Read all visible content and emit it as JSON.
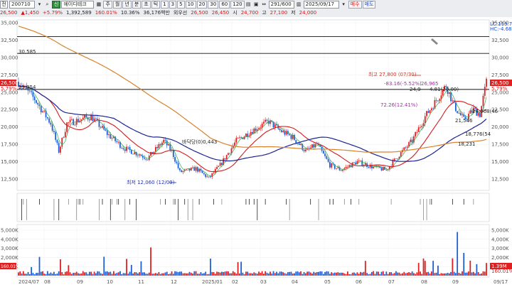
{
  "toolbar": {
    "row1": {
      "menu_label": "전",
      "stock_code": "200710",
      "dropdown_icon": "chevron-down-icon",
      "search_icon": "search-icon",
      "badge": "신",
      "stock_name": "에이디테크",
      "period_buttons": [
        "주",
        "월",
        "년",
        "분",
        "초",
        "틱"
      ],
      "interval_buttons": [
        "1",
        "3",
        "5",
        "10",
        "20",
        "30",
        "60",
        "120"
      ],
      "count_value": "291/600",
      "date_value": "2025/09/17",
      "mode_buttons": [
        "매수",
        "매도"
      ]
    },
    "row2": {
      "price": "26,500",
      "change": "1,450",
      "change_pct": "+5.79%",
      "volume": "1,392,589",
      "vol_ratio": "160.01%",
      "turnover": "10.36%",
      "amount": "36,176백만",
      "foreign_label": "외우선",
      "open_value": "26,500",
      "prev_value": "26,450",
      "open_label": "시",
      "open_price": "24,700",
      "high_label": "고",
      "high_price": "27,100",
      "low_label": "저",
      "low_price": "24,000"
    }
  },
  "chart": {
    "price_axis_ticks": [
      "35,000",
      "32,500",
      "30,000",
      "27,500",
      "25,000",
      "22,500",
      "20,000",
      "17,500",
      "15,000",
      "12,500"
    ],
    "volume_axis_ticks": [
      "5,000K",
      "4,000K",
      "3,000K",
      "2,000K",
      "1,000K"
    ],
    "left_ticks": [
      "35,000",
      "32,500",
      "30,000",
      "27,500",
      "25,000",
      "22,500",
      "20,000",
      "17,500",
      "15,000",
      "12,500"
    ],
    "left_price_box": "26,500",
    "left_pct": "5.79%",
    "left_level_label": "30,585",
    "left_low_label": "25,954",
    "left_vol_ticks": [
      "5,000K",
      "4,000K",
      "3,000K",
      "2,000K",
      "1,000K"
    ],
    "left_vol_box": "160.01%",
    "x_ticks": [
      "2024/07",
      "08",
      "09",
      "10",
      "11",
      "12",
      "2025/01",
      "02",
      "03",
      "04",
      "05",
      "06",
      "07",
      "08",
      "09",
      "09/17"
    ],
    "annotations": {
      "high": "최고 27,800 (07/30)",
      "pct1": "-83.16(-5.52%)",
      "pct1b": "26,965",
      "pct2": "72.26(12.41%)",
      "mid1": "24,9",
      "mid2": "4.81(20.00)",
      "mid3": "21,546",
      "mid4": "24.008(46",
      "low": "최저 12,060 (12/09)",
      "mid_text": "바닥당(0)0,443",
      "lc_right1": "LC:119.73",
      "lc_right2": "HC:-4.68",
      "right_label1": "18,776(54",
      "right_label2": "18,231",
      "right_price": "26,500",
      "right_pct": "5.79%",
      "vol_right1": "1.39M",
      "vol_right2": "160.01%"
    },
    "colors": {
      "up": "#e02020",
      "down": "#1f5fd6",
      "ma_red": "#d41c1c",
      "ma_navy": "#1d2590",
      "ma_orange": "#d9822b",
      "ma_green": "#2fa84f",
      "hline": "#111111"
    }
  }
}
